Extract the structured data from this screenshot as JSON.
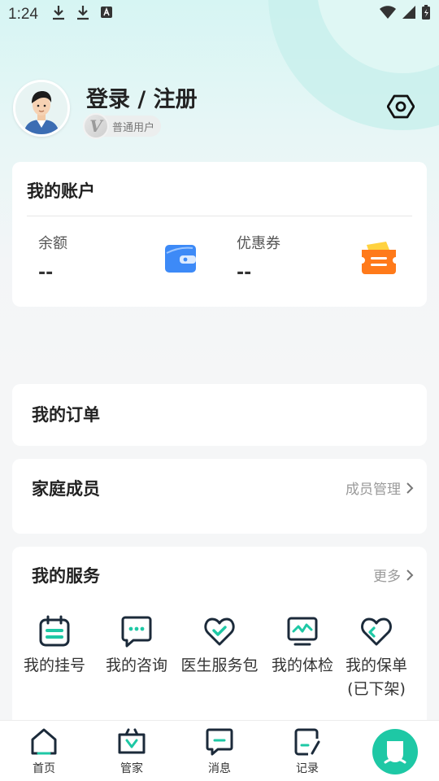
{
  "status_bar": {
    "time": "1:24",
    "icons": [
      "download-icon",
      "download-icon",
      "keyboard-a-icon"
    ],
    "right_icons": [
      "wifi-icon",
      "signal-icon",
      "battery-charging-icon"
    ]
  },
  "profile": {
    "login_label": "登录 / 注册",
    "badge_letter": "V",
    "badge_label": "普通用户"
  },
  "account": {
    "title": "我的账户",
    "balance_label": "余额",
    "balance_value": "--",
    "coupon_label": "优惠券",
    "coupon_value": "--"
  },
  "orders": {
    "title": "我的订单"
  },
  "family": {
    "title": "家庭成员",
    "link": "成员管理"
  },
  "services": {
    "title": "我的服务",
    "link": "更多",
    "items": [
      {
        "label": "我的挂号",
        "icon": "calendar-icon"
      },
      {
        "label": "我的咨询",
        "icon": "chat-icon"
      },
      {
        "label": "医生服务包",
        "icon": "heart-check-icon"
      },
      {
        "label": "我的体检",
        "icon": "monitor-icon"
      },
      {
        "label": "我的保单(已下架)",
        "label_line1": "我的保单",
        "label_line2": "(已下架)",
        "icon": "shield-heart-icon"
      }
    ]
  },
  "tabbar": {
    "items": [
      {
        "label": "首页",
        "icon": "home-icon"
      },
      {
        "label": "管家",
        "icon": "butler-icon"
      },
      {
        "label": "消息",
        "icon": "message-icon"
      },
      {
        "label": "记录",
        "icon": "record-icon"
      },
      {
        "label": "",
        "icon": "user-icon"
      }
    ]
  },
  "colors": {
    "accent": "#1ec8a5",
    "icon_dark": "#1b2a3a",
    "wallet_blue": "#3d8af7",
    "coupon_orange": "#ff7a1a"
  }
}
